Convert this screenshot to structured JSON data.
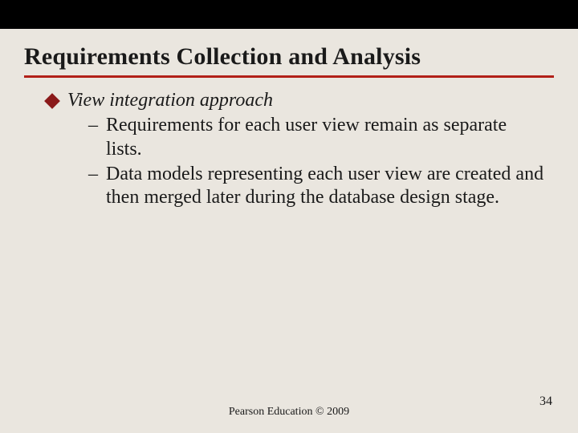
{
  "slide": {
    "title": "Requirements Collection and Analysis",
    "main_bullet_label": "View integration approach",
    "sub_bullets": [
      "Requirements for each user view remain as separate lists.",
      "Data models representing each user view are created and then merged later during the database design stage."
    ],
    "footer": "Pearson Education © 2009",
    "page_number": "34"
  }
}
